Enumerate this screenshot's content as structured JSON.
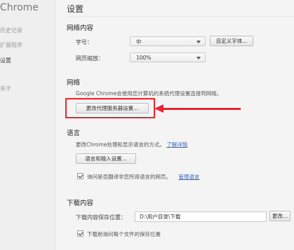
{
  "app": {
    "title": "Chrome"
  },
  "sidebar": {
    "items": [
      {
        "label": "历史记录"
      },
      {
        "label": "扩展程序"
      },
      {
        "label": "设置"
      },
      {
        "label": "关于"
      }
    ]
  },
  "page": {
    "title": "设置"
  },
  "web_content": {
    "section_title": "网络内容",
    "font_size_label": "字号：",
    "font_size_value": "中",
    "custom_fonts_button": "自定义字体...",
    "zoom_label": "网页缩放：",
    "zoom_value": "100%"
  },
  "network": {
    "section_title": "网络",
    "description": "Google Chrome会使用您计算机的系统代理设置连接到网络。",
    "proxy_button": "更改代理服务器设置..."
  },
  "languages": {
    "section_title": "语言",
    "description": "更改Chrome处理和显示语言的方式。",
    "learn_more_link": "了解详情",
    "input_settings_button": "语言和输入设置...",
    "translate_checkbox_label": "询问是否翻译非您所用语言的网页。",
    "manage_languages_link": "管理语言"
  },
  "downloads": {
    "section_title": "下载内容",
    "location_label": "下载内容保存位置：",
    "location_value": "D:\\用户目录\\下载",
    "change_button": "更改...",
    "ask_checkbox_label": "下载前询问每个文件的保存位置"
  },
  "annotation": {
    "color": "#e8262d"
  }
}
